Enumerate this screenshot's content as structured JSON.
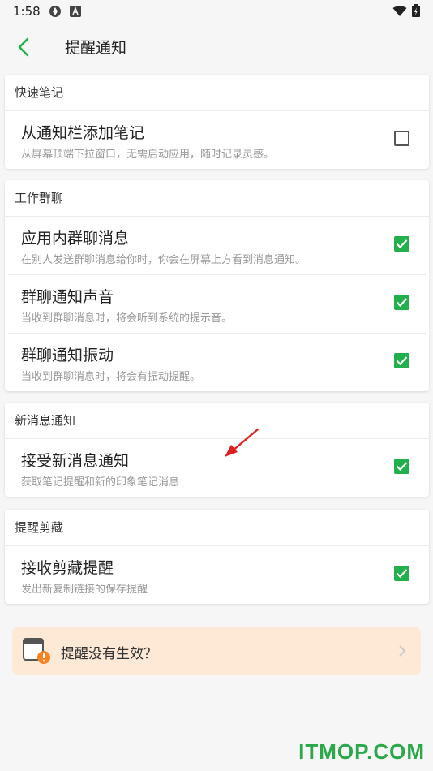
{
  "status_bar": {
    "time": "1:58"
  },
  "header": {
    "title": "提醒通知"
  },
  "sections": [
    {
      "title": "快速笔记",
      "items": [
        {
          "title": "从通知栏添加笔记",
          "desc": "从屏幕顶端下拉窗口，无需启动应用，随时记录灵感。",
          "checked": false
        }
      ]
    },
    {
      "title": "工作群聊",
      "items": [
        {
          "title": "应用内群聊消息",
          "desc": "在别人发送群聊消息给你时，你会在屏幕上方看到消息通知。",
          "checked": true
        },
        {
          "title": "群聊通知声音",
          "desc": "当收到群聊消息时，将会听到系统的提示音。",
          "checked": true
        },
        {
          "title": "群聊通知振动",
          "desc": "当收到群聊消息时，将会有振动提醒。",
          "checked": true
        }
      ]
    },
    {
      "title": "新消息通知",
      "items": [
        {
          "title": "接受新消息通知",
          "desc": "获取笔记提醒和新的印象笔记消息",
          "checked": true
        }
      ]
    },
    {
      "title": "提醒剪藏",
      "items": [
        {
          "title": "接收剪藏提醒",
          "desc": "发出新复制链接的保存提醒",
          "checked": true
        }
      ]
    }
  ],
  "tip": {
    "text": "提醒没有生效？"
  },
  "watermark": "ITMOP.COM",
  "colors": {
    "accent": "#21b04b",
    "banner": "#fde9d6",
    "arrow": "#e02020"
  }
}
